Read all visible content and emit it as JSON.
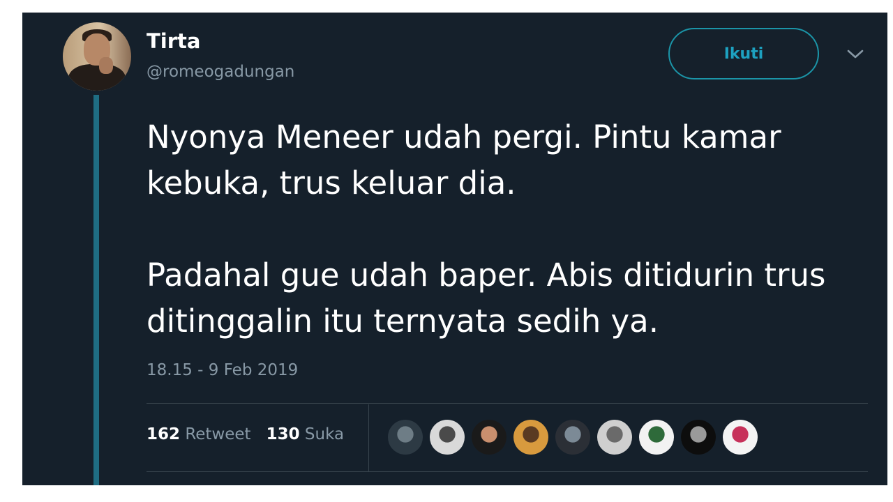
{
  "user": {
    "name": "Tirta",
    "handle": "@romeogadungan"
  },
  "follow_button": {
    "label": "Ikuti"
  },
  "tweet": {
    "paragraphs": [
      "Nyonya Meneer udah pergi. Pintu kamar kebuka, trus keluar dia.",
      "Padahal gue udah baper. Abis ditidurin trus ditinggalin itu ternyata sedih ya."
    ],
    "timestamp": "18.15 - 9 Feb 2019"
  },
  "stats": {
    "retweets_count": "162",
    "retweets_label": "Retweet",
    "likes_count": "130",
    "likes_label": "Suka"
  },
  "likers": [
    {
      "colors": [
        "#2d3a44",
        "#6e7d86"
      ]
    },
    {
      "colors": [
        "#d9d9d9",
        "#4a4a4a"
      ]
    },
    {
      "colors": [
        "#1a1a1a",
        "#c98f6e"
      ]
    },
    {
      "colors": [
        "#d89a3e",
        "#5a3a22"
      ]
    },
    {
      "colors": [
        "#2b2f36",
        "#7c8a96"
      ]
    },
    {
      "colors": [
        "#cfcfcf",
        "#6a6a6a"
      ]
    },
    {
      "colors": [
        "#f2f2f2",
        "#2e6a3a"
      ]
    },
    {
      "colors": [
        "#0d0d0d",
        "#9a9a9a"
      ]
    },
    {
      "colors": [
        "#f4f4f4",
        "#c7315a"
      ]
    }
  ],
  "colors": {
    "background": "#15202b",
    "accent": "#1da1f2",
    "muted": "#8899a6"
  }
}
